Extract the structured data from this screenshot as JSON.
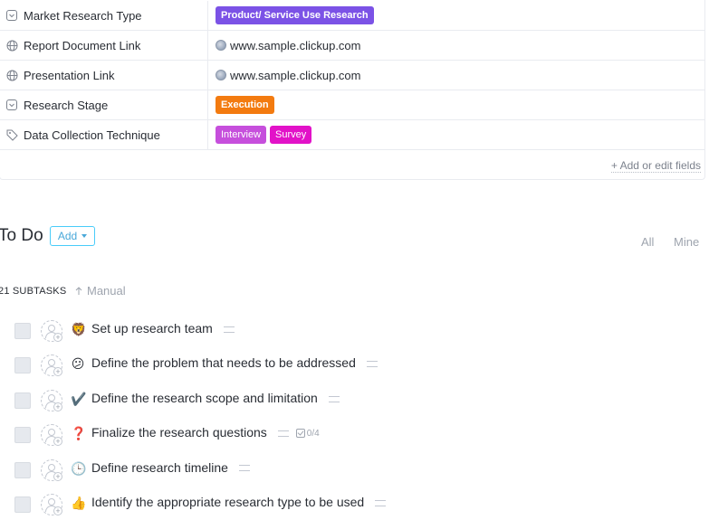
{
  "fields": [
    {
      "label": "Market Research Type",
      "icon": "dropdown-icon",
      "type": "tags",
      "tags": [
        {
          "text": "Product/ Service Use Research",
          "color": "#7b52e6"
        }
      ]
    },
    {
      "label": "Report Document Link",
      "icon": "globe-icon",
      "type": "link",
      "value": "www.sample.clickup.com"
    },
    {
      "label": "Presentation Link",
      "icon": "globe-icon",
      "type": "link",
      "value": "www.sample.clickup.com"
    },
    {
      "label": "Research Stage",
      "icon": "dropdown-icon",
      "type": "tags",
      "tags": [
        {
          "text": "Execution",
          "color": "#f37b10"
        }
      ]
    },
    {
      "label": "Data Collection Technique",
      "icon": "tag-icon",
      "type": "tags",
      "tags": [
        {
          "text": "Interview",
          "color": "#c64fdc"
        },
        {
          "text": "Survey",
          "color": "#e212c8"
        }
      ]
    }
  ],
  "add_edit_fields": "+ Add or edit fields",
  "todo": {
    "title": "To Do",
    "add_label": "Add",
    "filter_all": "All",
    "filter_mine": "Mine"
  },
  "subtasks": {
    "count_label": "21 SUBTASKS",
    "sort_label": "Manual"
  },
  "tasks": [
    {
      "emoji": "🦁",
      "name": "Set up research team",
      "checklist": ""
    },
    {
      "emoji": "😕",
      "name": "Define the problem that needs to be addressed",
      "checklist": ""
    },
    {
      "emoji": "✔️",
      "name": "Define the research scope and limitation",
      "checklist": ""
    },
    {
      "emoji": "❓",
      "name": "Finalize the research questions",
      "checklist": "0/4"
    },
    {
      "emoji": "🕒",
      "name": "Define research timeline",
      "checklist": ""
    },
    {
      "emoji": "👍",
      "name": "Identify the appropriate research type to be used",
      "checklist": ""
    }
  ],
  "colors": {
    "accent": "#49ccf9",
    "text": "#292d34",
    "muted": "#9ea4ae"
  }
}
